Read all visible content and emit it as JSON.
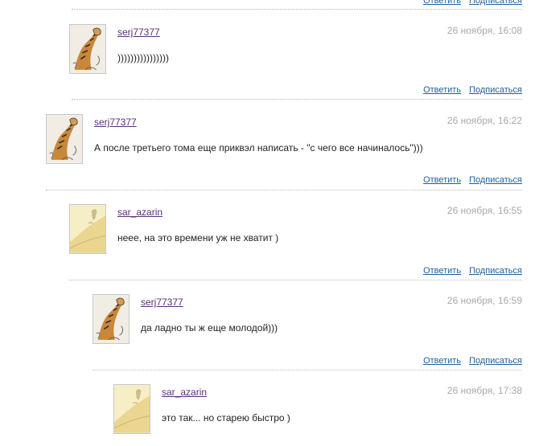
{
  "actions": {
    "reply_label": "Ответить",
    "subscribe_label": "Подписаться"
  },
  "comments": [
    {
      "author": "serj77377",
      "date": "26 ноября, 16:08",
      "text": "))))))))))))))))",
      "avatar": "tiger-avatar"
    },
    {
      "author": "serj77377",
      "date": "26 ноября, 16:22",
      "text": "А после третьего тома еще приквэл написать - \"с чего все начиналось\")))",
      "avatar": "tiger-avatar"
    },
    {
      "author": "sar_azarin",
      "date": "26 ноября, 16:55",
      "text": "неее, на это времени уж не хватит )",
      "avatar": "sand-avatar"
    },
    {
      "author": "serj77377",
      "date": "26 ноября, 16:59",
      "text": "да ладно ты ж еще молодой)))",
      "avatar": "tiger-avatar"
    },
    {
      "author": "sar_azarin",
      "date": "26 ноября, 17:38",
      "text": "это так... но старею быстро )",
      "avatar": "sand-avatar"
    }
  ]
}
